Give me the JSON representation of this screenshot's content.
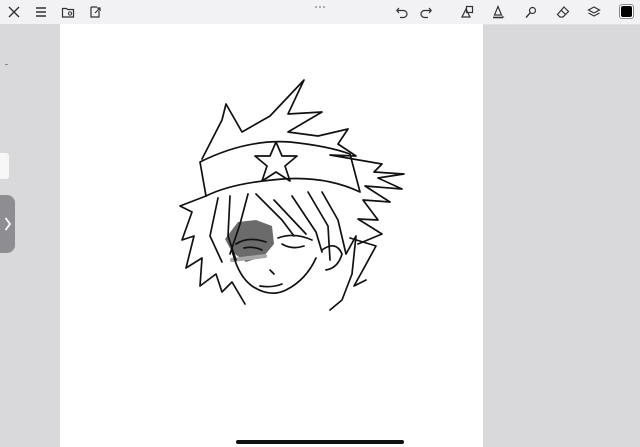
{
  "toolbar": {
    "left_icons": [
      "close-icon",
      "menu-icon",
      "gallery-icon",
      "export-icon"
    ],
    "right_icons": [
      "undo-icon",
      "redo-icon",
      "shape-icon",
      "pen-icon",
      "brush-icon",
      "eraser-icon",
      "layers-icon"
    ],
    "current_color": "#000000"
  },
  "canvas": {
    "background": "#ffffff",
    "stroke_color": "#111111",
    "shade_color": "#6b6b6b"
  },
  "colors": {
    "workspace": "#d9d9db",
    "toolbar": "#f2f2f4",
    "side_handle": "#8d8d92"
  }
}
